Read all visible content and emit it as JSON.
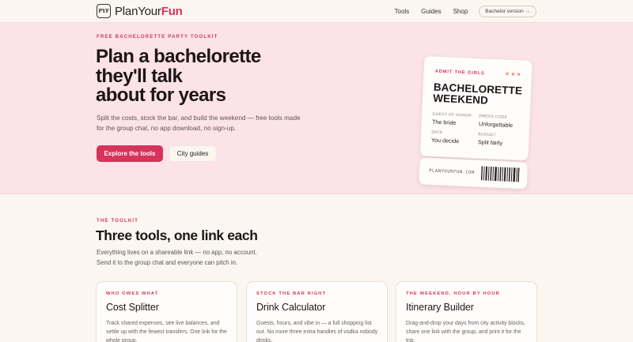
{
  "header": {
    "logo_badge": "PYF",
    "logo_text_plain": "PlanYour",
    "logo_text_accent": "Fun",
    "nav": [
      {
        "label": "Tools"
      },
      {
        "label": "Guides"
      },
      {
        "label": "Shop"
      }
    ],
    "version_pill": "Bachelor version →"
  },
  "hero": {
    "eyebrow": "FREE BACHELORETTE PARTY TOOLKIT",
    "title_line1": "Plan a bachelorette",
    "title_line2": "they'll talk",
    "title_line3": "about for years",
    "description": "Split the costs, stock the bar, and build the weekend — free tools made for the group chat, no app download, no sign-up.",
    "primary_button": "Explore the tools",
    "secondary_button": "City guides"
  },
  "ticket": {
    "admit": "ADMIT THE GIRLS",
    "stars": "★★★",
    "title_line1": "BACHELORETTE",
    "title_line2": "WEEKEND",
    "fields": [
      {
        "label": "GUEST OF HONOR",
        "value": "The bride"
      },
      {
        "label": "DRESS CODE",
        "value": "Unforgettable"
      },
      {
        "label": "DATE",
        "value": "You decide"
      },
      {
        "label": "BUDGET",
        "value": "Split fairly"
      }
    ],
    "url": "PLANYOURFUN.COM"
  },
  "toolkit": {
    "eyebrow": "THE TOOLKIT",
    "title": "Three tools, one link each",
    "description_line1": "Everything lives on a shareable link — no app, no account.",
    "description_line2": "Send it to the group chat and everyone can pitch in.",
    "cards": [
      {
        "eyebrow": "WHO OWES WHAT",
        "title": "Cost Splitter",
        "description": "Track shared expenses, see live balances, and settle up with the fewest transfers. One link for the whole group."
      },
      {
        "eyebrow": "STOCK THE BAR RIGHT",
        "title": "Drink Calculator",
        "description": "Guests, hours, and vibe in — a full shopping list out. No more three extra handles of vodka nobody drinks."
      },
      {
        "eyebrow": "THE WEEKEND, HOUR BY HOUR",
        "title": "Itinerary Builder",
        "description": "Drag-and-drop your days from city activity blocks, share one link with the group, and print it for the trip."
      }
    ]
  },
  "colors": {
    "accent": "#d6345a",
    "hero_bg": "#fce3e7",
    "page_bg": "#fbf6ef"
  }
}
